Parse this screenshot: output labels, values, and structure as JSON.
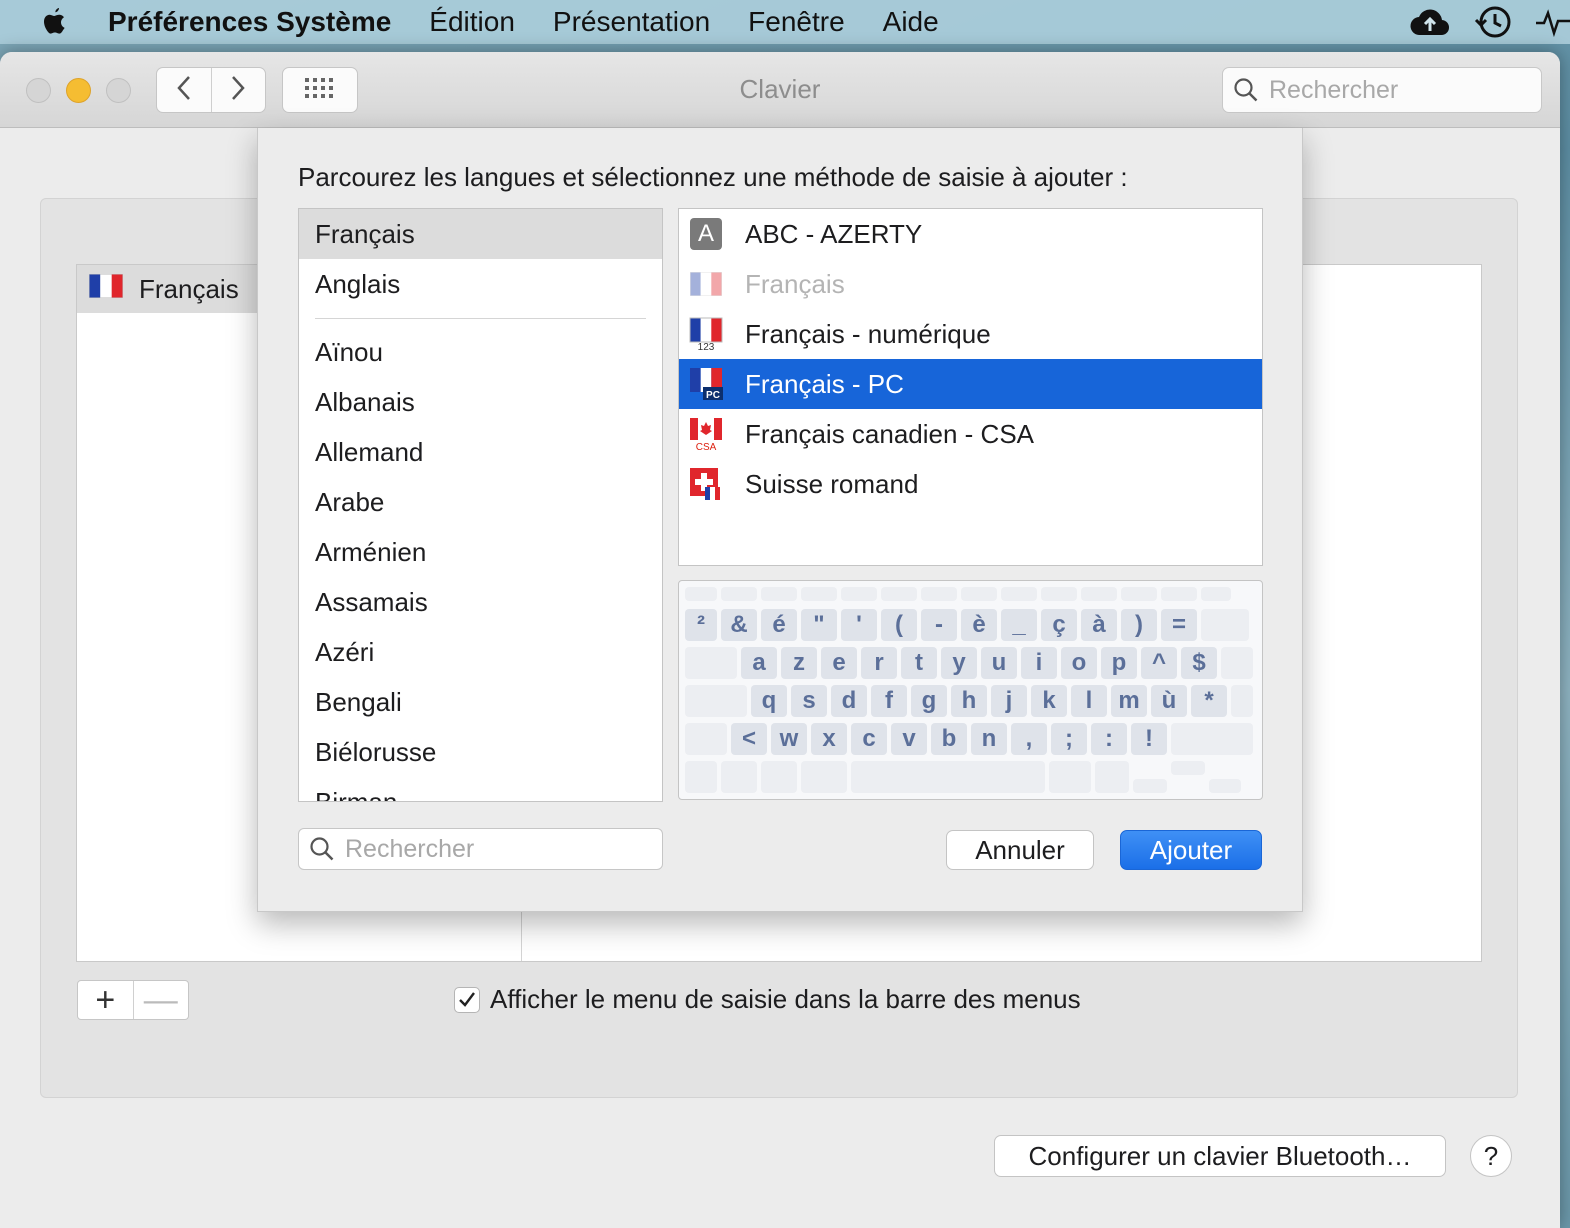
{
  "menubar": {
    "app_name": "Préférences Système",
    "items": [
      "Édition",
      "Présentation",
      "Fenêtre",
      "Aide"
    ],
    "right_icons": [
      "icloud-upload-icon",
      "time-machine-icon",
      "activity-icon"
    ]
  },
  "window": {
    "title": "Clavier",
    "search_placeholder": "Rechercher"
  },
  "background": {
    "input_sources": [
      {
        "label": "Français",
        "icon": "flag-fr-icon"
      }
    ],
    "plus_label": "+",
    "minus_label": "—",
    "show_menu_label": "Afficher le menu de saisie dans la barre des menus",
    "show_menu_checked": true,
    "bluetooth_button": "Configurer un clavier Bluetooth…",
    "help_label": "?"
  },
  "sheet": {
    "prompt": "Parcourez les langues et sélectionnez une méthode de saisie à ajouter :",
    "languages_top": [
      "Français",
      "Anglais"
    ],
    "languages": [
      "Aïnou",
      "Albanais",
      "Allemand",
      "Arabe",
      "Arménien",
      "Assamais",
      "Azéri",
      "Bengali",
      "Biélorusse",
      "Birman"
    ],
    "selected_language": "Français",
    "methods": [
      {
        "label": "ABC - AZERTY",
        "icon": "abc-icon",
        "state": "normal"
      },
      {
        "label": "Français",
        "icon": "flag-fr-icon",
        "state": "disabled"
      },
      {
        "label": "Français - numérique",
        "icon": "flag-fr-123-icon",
        "state": "normal"
      },
      {
        "label": "Français - PC",
        "icon": "flag-fr-pc-icon",
        "state": "selected"
      },
      {
        "label": "Français canadien - CSA",
        "icon": "flag-ca-csa-icon",
        "state": "normal"
      },
      {
        "label": "Suisse romand",
        "icon": "flag-ch-icon",
        "state": "normal"
      }
    ],
    "keyboard_rows": [
      [
        "²",
        "&",
        "é",
        "\"",
        "'",
        "(",
        "-",
        "è",
        "_",
        "ç",
        "à",
        ")",
        "="
      ],
      [
        "a",
        "z",
        "e",
        "r",
        "t",
        "y",
        "u",
        "i",
        "o",
        "p",
        "^",
        "$"
      ],
      [
        "q",
        "s",
        "d",
        "f",
        "g",
        "h",
        "j",
        "k",
        "l",
        "m",
        "ù",
        "*"
      ],
      [
        "<",
        "w",
        "x",
        "c",
        "v",
        "b",
        "n",
        ",",
        ";",
        ":",
        "!"
      ]
    ],
    "search_placeholder": "Rechercher",
    "cancel_label": "Annuler",
    "add_label": "Ajouter",
    "accent_color": "#1765d9"
  }
}
